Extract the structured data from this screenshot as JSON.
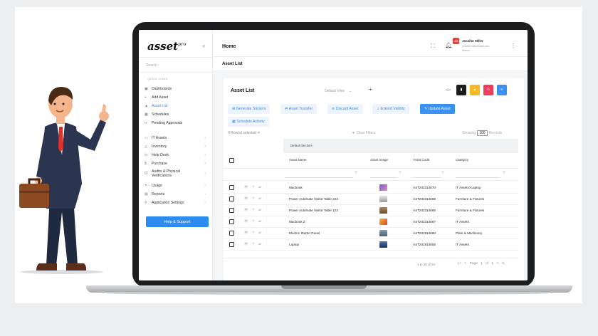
{
  "brand": {
    "logo": "asset",
    "logo_sup": "pro"
  },
  "sidebar": {
    "search_placeholder": "Search",
    "quick_links": "QUICK LINKS",
    "items": [
      {
        "label": "Dashboards",
        "icon": "grid-icon"
      },
      {
        "label": "Add Asset",
        "icon": "plus-icon"
      },
      {
        "label": "Asset List",
        "icon": "cluster-icon"
      },
      {
        "label": "Schedules",
        "icon": "calendar-icon"
      },
      {
        "label": "Pending Approvals",
        "icon": "approval-icon"
      },
      {
        "label": "IT Assets",
        "icon": "monitor-icon"
      },
      {
        "label": "Inventory",
        "icon": "box-icon"
      },
      {
        "label": "Help Desk",
        "icon": "support-icon"
      },
      {
        "label": "Purchase",
        "icon": "dollar-icon"
      },
      {
        "label": "Audits & Physical Verifications",
        "icon": "audit-icon"
      },
      {
        "label": "Usage",
        "icon": "usage-icon"
      },
      {
        "label": "Reports",
        "icon": "report-icon"
      },
      {
        "label": "Application Settings",
        "icon": "wrench-icon"
      }
    ],
    "help_button": "Help & Support"
  },
  "topbar": {
    "title": "Home",
    "avatar_initials": "JM",
    "user_name": "Jennifer Miller",
    "user_email": "jennifer.miller@test.com",
    "user_role": "demo4"
  },
  "subbar": {
    "title": "Asset List"
  },
  "card": {
    "title": "Asset List",
    "view_select": "Default View",
    "code_icon": "</>",
    "action_buttons": [
      "Generate Stickers",
      "Asset Transfer",
      "Discard Asset",
      "Extend Validity",
      "Update Asset",
      "Schedule Activity"
    ],
    "rows_selected": "0 Row(s) selected",
    "clear_filters": "Clear Filters",
    "showing_label": "Showing",
    "showing_value": "100",
    "records_label": "Records",
    "section_header": "Default Section",
    "columns": [
      "Asset Name",
      "Asset Image",
      "Asset Code",
      "Category"
    ],
    "rows": [
      {
        "name": "Macbook",
        "code": "AST202314670",
        "category": "IT Assets>Laptop"
      },
      {
        "name": "Power Automate Visitor Table 223",
        "code": "AST202314669",
        "category": "Furniture & Fixtures"
      },
      {
        "name": "Power Automate Visitor Table 123",
        "code": "AST202314668",
        "category": "Furniture & Fixtures"
      },
      {
        "name": "Macbook Z",
        "code": "AST202314667",
        "category": "IT Assets"
      },
      {
        "name": "Electric Starter Panel",
        "code": "AST201914660",
        "category": "Plant & Machinery"
      },
      {
        "name": "Laptop",
        "code": "AST201914658",
        "category": "IT Assets"
      }
    ],
    "range_text": "1 to 20 of 20",
    "page_text": "Page 1 of 1"
  },
  "colors": {
    "accent": "#2d8cf0",
    "dark": "#1c1d1f",
    "yellow": "#f5b922",
    "red": "#ef3e5c",
    "blue": "#3a91f2"
  }
}
